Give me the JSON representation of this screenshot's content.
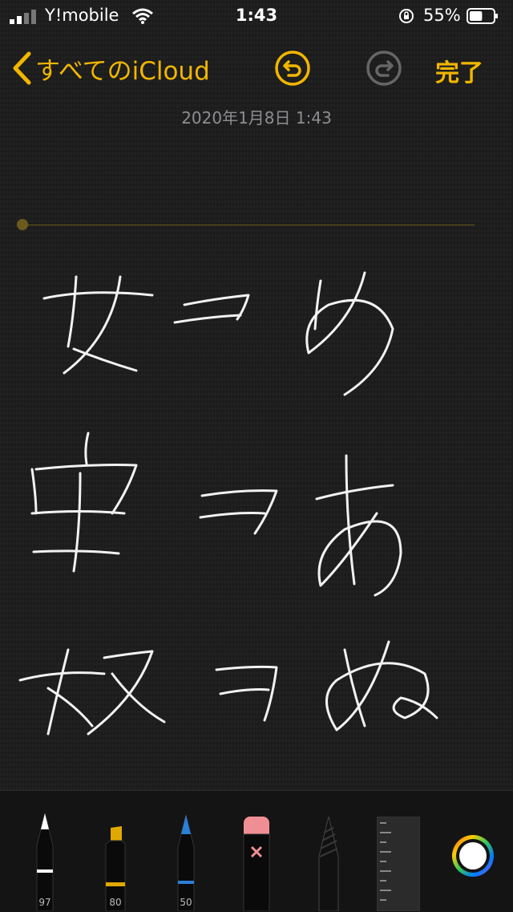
{
  "status_bar": {
    "carrier": "Y!mobile",
    "time": "1:43",
    "battery_percent": "55%",
    "battery_level": 0.55
  },
  "nav": {
    "back_label": "すべてのiCloud",
    "done_label": "完了",
    "accent_color": "#f2b600"
  },
  "note": {
    "date": "2020年1月8日 1:43"
  },
  "toolbar": {
    "tools": [
      {
        "name": "pen",
        "value": "97",
        "tip_color": "#ffffff"
      },
      {
        "name": "marker",
        "value": "80",
        "tip_color": "#e0a800"
      },
      {
        "name": "pencil",
        "value": "50",
        "tip_color": "#2a7fd6"
      },
      {
        "name": "eraser"
      },
      {
        "name": "lasso"
      },
      {
        "name": "ruler"
      }
    ],
    "selected_color": "#ffffff"
  }
}
